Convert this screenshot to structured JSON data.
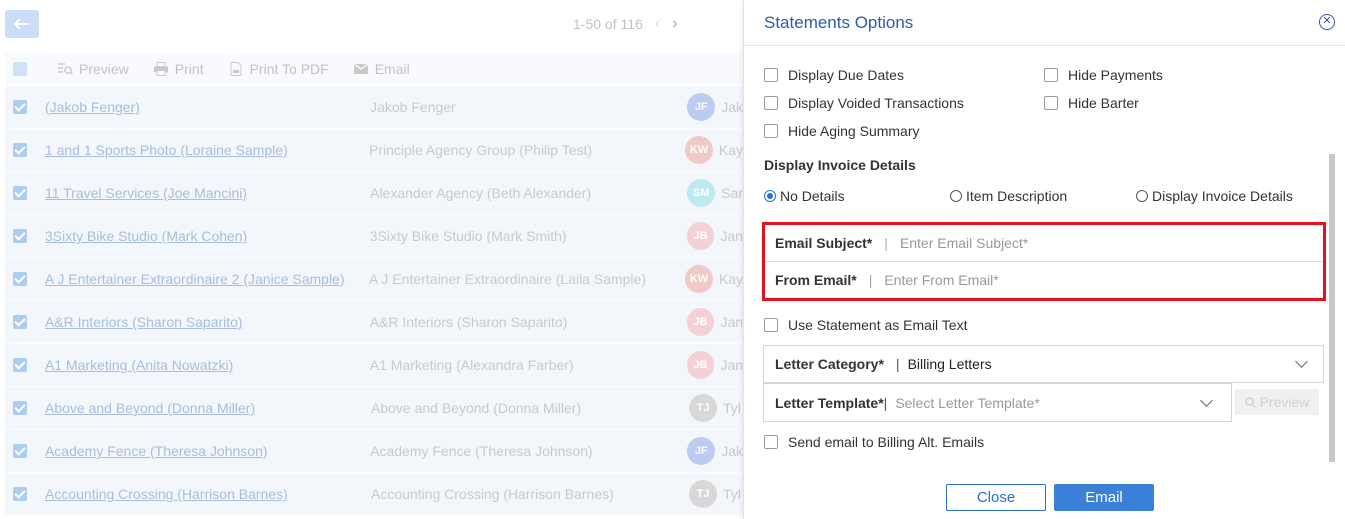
{
  "list": {
    "pager_text": "1-50 of 116",
    "toolbar": {
      "preview": "Preview",
      "print": "Print",
      "print_pdf": "Print To PDF",
      "email": "Email"
    },
    "rows": [
      {
        "customer": "(Jakob Fenger)",
        "agency": "Jakob Fenger",
        "initials": "JF",
        "color": "#6b8fe0",
        "rep": "Jak"
      },
      {
        "customer": "1 and 1 Sports Photo (Loraine Sample)",
        "agency": "Principle Agency Group (Philip Test)",
        "initials": "KW",
        "color": "#e08a8a",
        "rep": "Kay"
      },
      {
        "customer": "11 Travel Services (Joe Mancini)",
        "agency": "Alexander Agency (Beth Alexander)",
        "initials": "SM",
        "color": "#6fcfe0",
        "rep": "Sar"
      },
      {
        "customer": "3Sixty Bike Studio (Mark Cohen)",
        "agency": "3Sixty Bike Studio (Mark Smith)",
        "initials": "JB",
        "color": "#e59aa6",
        "rep": "Jan"
      },
      {
        "customer": "A J Entertainer Extraordinaire 2 (Janice Sample)",
        "agency": "A J Entertainer Extraordinaire (Laila Sample)",
        "initials": "KW",
        "color": "#e08a8a",
        "rep": "Kay"
      },
      {
        "customer": "A&R Interiors (Sharon Saparito)",
        "agency": "A&R Interiors (Sharon Saparito)",
        "initials": "JB",
        "color": "#e59aa6",
        "rep": "Jan"
      },
      {
        "customer": "A1 Marketing (Anita Nowatzki)",
        "agency": "A1 Marketing (Alexandra Farber)",
        "initials": "JB",
        "color": "#e59aa6",
        "rep": "Jan"
      },
      {
        "customer": "Above and Beyond (Donna Miller)",
        "agency": "Above and Beyond (Donna Miller)",
        "initials": "TJ",
        "color": "#a9a9a9",
        "rep": "Tyl"
      },
      {
        "customer": "Academy Fence (Theresa Johnson)",
        "agency": "Academy Fence (Theresa Johnson)",
        "initials": "JF",
        "color": "#6b8fe0",
        "rep": "Jak"
      },
      {
        "customer": "Accounting Crossing (Harrison Barnes)",
        "agency": "Accounting Crossing (Harrison Barnes)",
        "initials": "TJ",
        "color": "#a9a9a9",
        "rep": "Tyl"
      }
    ]
  },
  "panel": {
    "title": "Statements Options",
    "options": {
      "due_dates": "Display Due Dates",
      "hide_payments": "Hide Payments",
      "voided": "Display Voided Transactions",
      "hide_barter": "Hide Barter",
      "hide_aging": "Hide Aging Summary"
    },
    "invoice_section_title": "Display Invoice Details",
    "radios": {
      "no_details": "No Details",
      "item_desc": "Item Description",
      "display_details": "Display Invoice Details"
    },
    "email_subject": {
      "label": "Email Subject*",
      "placeholder": "Enter Email Subject*"
    },
    "from_email": {
      "label": "From Email*",
      "placeholder": "Enter From Email*"
    },
    "use_statement": "Use Statement as Email Text",
    "letter_category": {
      "label": "Letter Category*",
      "value": "Billing Letters"
    },
    "letter_template": {
      "label": "Letter Template*",
      "placeholder": "Select Letter Template*"
    },
    "preview_label": "Preview",
    "billing_alt": "Send email to Billing Alt. Emails",
    "close_label": "Close",
    "email_label": "Email"
  }
}
